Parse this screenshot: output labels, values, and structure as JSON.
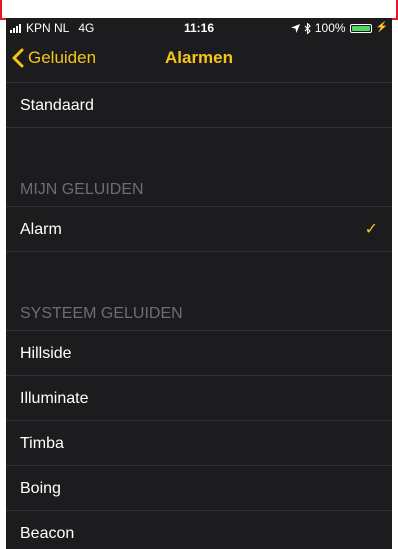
{
  "status_bar": {
    "carrier": "KPN NL",
    "network": "4G",
    "time": "11:16",
    "battery": "100%",
    "battery_level": 1.0
  },
  "nav": {
    "back_label": "Geluiden",
    "title": "Alarmen"
  },
  "rows": {
    "standard": "Standaard"
  },
  "sections": {
    "mine": {
      "header": "MIJN GELUIDEN",
      "items": [
        "Alarm"
      ],
      "selected": "Alarm"
    },
    "system": {
      "header": "SYSTEEM GELUIDEN",
      "items": [
        "Hillside",
        "Illuminate",
        "Timba",
        "Boing",
        "Beacon"
      ]
    }
  },
  "icons": {
    "checkmark": "checkmark-icon",
    "chevron": "chevron-left-icon",
    "location": "location-arrow-icon",
    "bluetooth": "bluetooth-icon"
  },
  "colors": {
    "accent": "#f5c518",
    "background": "#1c1c1e",
    "battery": "#4cd964"
  }
}
